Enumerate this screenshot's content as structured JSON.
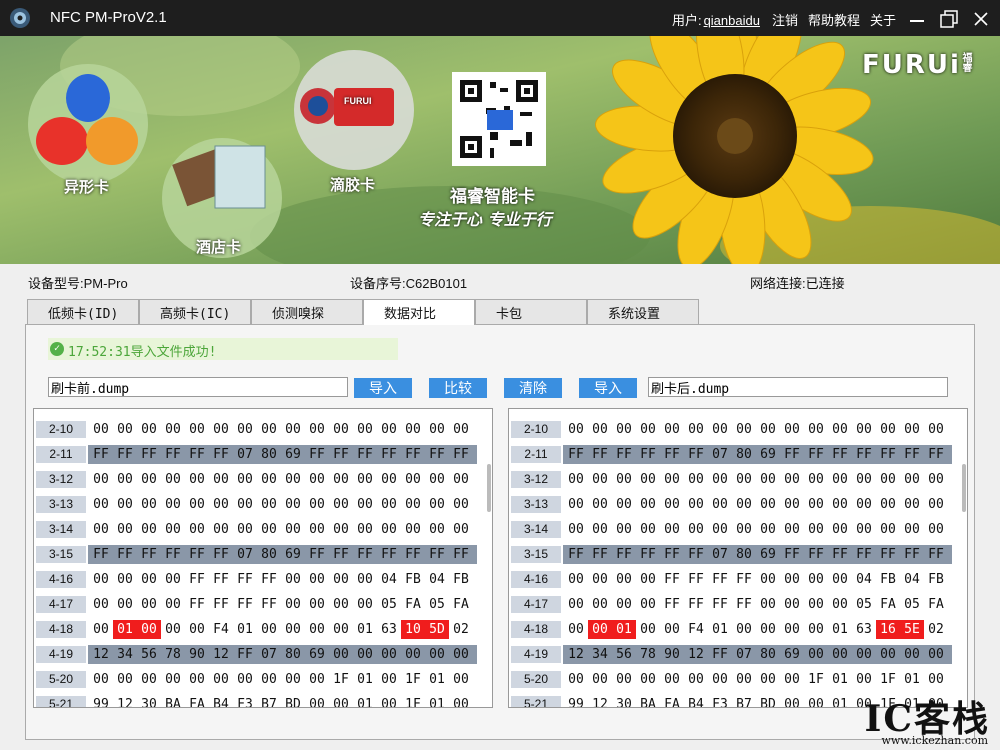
{
  "titlebar": {
    "title": "NFC PM-ProV2.1",
    "user_label": "用户:",
    "username": "qianbaidu",
    "logout": "注销",
    "help": "帮助教程",
    "about": "关于"
  },
  "banner": {
    "circle1": "异形卡",
    "circle2": "酒店卡",
    "circle3": "滴胶卡",
    "company": "福睿智能卡",
    "slogan": "专注于心 专业于行",
    "brand": "FURUi",
    "brand_cn": "福睿",
    "card_tag": "FURUI"
  },
  "info": {
    "model": "设备型号:PM-Pro",
    "serial": "设备序号:C62B0101",
    "network": "网络连接:已连接"
  },
  "tabs": [
    "低频卡(ID)",
    "高频卡(IC)",
    "侦测嗅探",
    "数据对比",
    "卡包",
    "系统设置"
  ],
  "active_tab": 3,
  "status": "17:52:31导入文件成功!",
  "left_file": "刷卡前.dump",
  "right_file": "刷卡后.dump",
  "buttons": {
    "import_left": "导入",
    "compare": "比较",
    "clear": "清除",
    "import_right": "导入"
  },
  "left_rows": [
    {
      "label": "2-10",
      "dark": false,
      "bytes": [
        "00",
        "00",
        "00",
        "00",
        "00",
        "00",
        "00",
        "00",
        "00",
        "00",
        "00",
        "00",
        "00",
        "00",
        "00",
        "00"
      ]
    },
    {
      "label": "2-11",
      "dark": true,
      "bytes": [
        "FF",
        "FF",
        "FF",
        "FF",
        "FF",
        "FF",
        "07",
        "80",
        "69",
        "FF",
        "FF",
        "FF",
        "FF",
        "FF",
        "FF",
        "FF"
      ]
    },
    {
      "label": "3-12",
      "dark": false,
      "bytes": [
        "00",
        "00",
        "00",
        "00",
        "00",
        "00",
        "00",
        "00",
        "00",
        "00",
        "00",
        "00",
        "00",
        "00",
        "00",
        "00"
      ]
    },
    {
      "label": "3-13",
      "dark": false,
      "bytes": [
        "00",
        "00",
        "00",
        "00",
        "00",
        "00",
        "00",
        "00",
        "00",
        "00",
        "00",
        "00",
        "00",
        "00",
        "00",
        "00"
      ]
    },
    {
      "label": "3-14",
      "dark": false,
      "bytes": [
        "00",
        "00",
        "00",
        "00",
        "00",
        "00",
        "00",
        "00",
        "00",
        "00",
        "00",
        "00",
        "00",
        "00",
        "00",
        "00"
      ]
    },
    {
      "label": "3-15",
      "dark": true,
      "bytes": [
        "FF",
        "FF",
        "FF",
        "FF",
        "FF",
        "FF",
        "07",
        "80",
        "69",
        "FF",
        "FF",
        "FF",
        "FF",
        "FF",
        "FF",
        "FF"
      ]
    },
    {
      "label": "4-16",
      "dark": false,
      "bytes": [
        "00",
        "00",
        "00",
        "00",
        "FF",
        "FF",
        "FF",
        "FF",
        "00",
        "00",
        "00",
        "00",
        "04",
        "FB",
        "04",
        "FB"
      ]
    },
    {
      "label": "4-17",
      "dark": false,
      "bytes": [
        "00",
        "00",
        "00",
        "00",
        "FF",
        "FF",
        "FF",
        "FF",
        "00",
        "00",
        "00",
        "00",
        "05",
        "FA",
        "05",
        "FA"
      ]
    },
    {
      "label": "4-18",
      "dark": false,
      "bytes": [
        "00",
        "01",
        "00",
        "00",
        "00",
        "F4",
        "01",
        "00",
        "00",
        "00",
        "00",
        "01",
        "63",
        "10",
        "5D",
        "02"
      ],
      "red": [
        1,
        2,
        13,
        14
      ]
    },
    {
      "label": "4-19",
      "dark": true,
      "bytes": [
        "12",
        "34",
        "56",
        "78",
        "90",
        "12",
        "FF",
        "07",
        "80",
        "69",
        "00",
        "00",
        "00",
        "00",
        "00",
        "00"
      ]
    },
    {
      "label": "5-20",
      "dark": false,
      "bytes": [
        "00",
        "00",
        "00",
        "00",
        "00",
        "00",
        "00",
        "00",
        "00",
        "00",
        "1F",
        "01",
        "00",
        "1F",
        "01",
        "00"
      ]
    },
    {
      "label": "5-21",
      "dark": false,
      "bytes": [
        "99",
        "12",
        "30",
        "BA",
        "FA",
        "B4",
        "F3",
        "B7",
        "BD",
        "00",
        "00",
        "01",
        "00",
        "1F",
        "01",
        "00"
      ]
    }
  ],
  "right_rows": [
    {
      "label": "2-10",
      "dark": false,
      "bytes": [
        "00",
        "00",
        "00",
        "00",
        "00",
        "00",
        "00",
        "00",
        "00",
        "00",
        "00",
        "00",
        "00",
        "00",
        "00",
        "00"
      ]
    },
    {
      "label": "2-11",
      "dark": true,
      "bytes": [
        "FF",
        "FF",
        "FF",
        "FF",
        "FF",
        "FF",
        "07",
        "80",
        "69",
        "FF",
        "FF",
        "FF",
        "FF",
        "FF",
        "FF",
        "FF"
      ]
    },
    {
      "label": "3-12",
      "dark": false,
      "bytes": [
        "00",
        "00",
        "00",
        "00",
        "00",
        "00",
        "00",
        "00",
        "00",
        "00",
        "00",
        "00",
        "00",
        "00",
        "00",
        "00"
      ]
    },
    {
      "label": "3-13",
      "dark": false,
      "bytes": [
        "00",
        "00",
        "00",
        "00",
        "00",
        "00",
        "00",
        "00",
        "00",
        "00",
        "00",
        "00",
        "00",
        "00",
        "00",
        "00"
      ]
    },
    {
      "label": "3-14",
      "dark": false,
      "bytes": [
        "00",
        "00",
        "00",
        "00",
        "00",
        "00",
        "00",
        "00",
        "00",
        "00",
        "00",
        "00",
        "00",
        "00",
        "00",
        "00"
      ]
    },
    {
      "label": "3-15",
      "dark": true,
      "bytes": [
        "FF",
        "FF",
        "FF",
        "FF",
        "FF",
        "FF",
        "07",
        "80",
        "69",
        "FF",
        "FF",
        "FF",
        "FF",
        "FF",
        "FF",
        "FF"
      ]
    },
    {
      "label": "4-16",
      "dark": false,
      "bytes": [
        "00",
        "00",
        "00",
        "00",
        "FF",
        "FF",
        "FF",
        "FF",
        "00",
        "00",
        "00",
        "00",
        "04",
        "FB",
        "04",
        "FB"
      ]
    },
    {
      "label": "4-17",
      "dark": false,
      "bytes": [
        "00",
        "00",
        "00",
        "00",
        "FF",
        "FF",
        "FF",
        "FF",
        "00",
        "00",
        "00",
        "00",
        "05",
        "FA",
        "05",
        "FA"
      ]
    },
    {
      "label": "4-18",
      "dark": false,
      "bytes": [
        "00",
        "00",
        "01",
        "00",
        "00",
        "F4",
        "01",
        "00",
        "00",
        "00",
        "00",
        "01",
        "63",
        "16",
        "5E",
        "02"
      ],
      "red": [
        1,
        2,
        13,
        14
      ]
    },
    {
      "label": "4-19",
      "dark": true,
      "bytes": [
        "12",
        "34",
        "56",
        "78",
        "90",
        "12",
        "FF",
        "07",
        "80",
        "69",
        "00",
        "00",
        "00",
        "00",
        "00",
        "00"
      ]
    },
    {
      "label": "5-20",
      "dark": false,
      "bytes": [
        "00",
        "00",
        "00",
        "00",
        "00",
        "00",
        "00",
        "00",
        "00",
        "00",
        "1F",
        "01",
        "00",
        "1F",
        "01",
        "00"
      ]
    },
    {
      "label": "5-21",
      "dark": false,
      "bytes": [
        "99",
        "12",
        "30",
        "BA",
        "FA",
        "B4",
        "F3",
        "B7",
        "BD",
        "00",
        "00",
        "01",
        "00",
        "1F",
        "01",
        "00"
      ]
    }
  ],
  "watermark": {
    "big": "IC客栈",
    "url": "www.ickezhan.com"
  },
  "colors": {
    "accent": "#3a8fe0",
    "diff": "#f01d1d",
    "dark_row": "#8a97a8",
    "success": "#54b148"
  }
}
